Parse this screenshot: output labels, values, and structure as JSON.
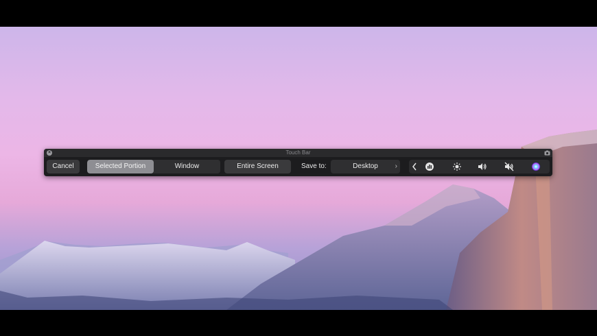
{
  "window": {
    "title": "Touch Bar"
  },
  "toolbar": {
    "cancel_label": "Cancel",
    "segments": [
      {
        "label": "Selected Portion",
        "selected": true
      },
      {
        "label": "Window",
        "selected": false
      }
    ],
    "entire_screen_label": "Entire Screen",
    "save_to_label": "Save to:",
    "save_destination": "Desktop"
  },
  "control_strip": {
    "icons": [
      "collapse-chevron-icon",
      "siri-remote-icon",
      "brightness-icon",
      "volume-icon",
      "mute-icon",
      "siri-icon"
    ]
  },
  "colors": {
    "touchbar_bg": "#1c1c1e",
    "button_bg": "#3a3a3c",
    "selected_bg": "#8e8e93"
  }
}
